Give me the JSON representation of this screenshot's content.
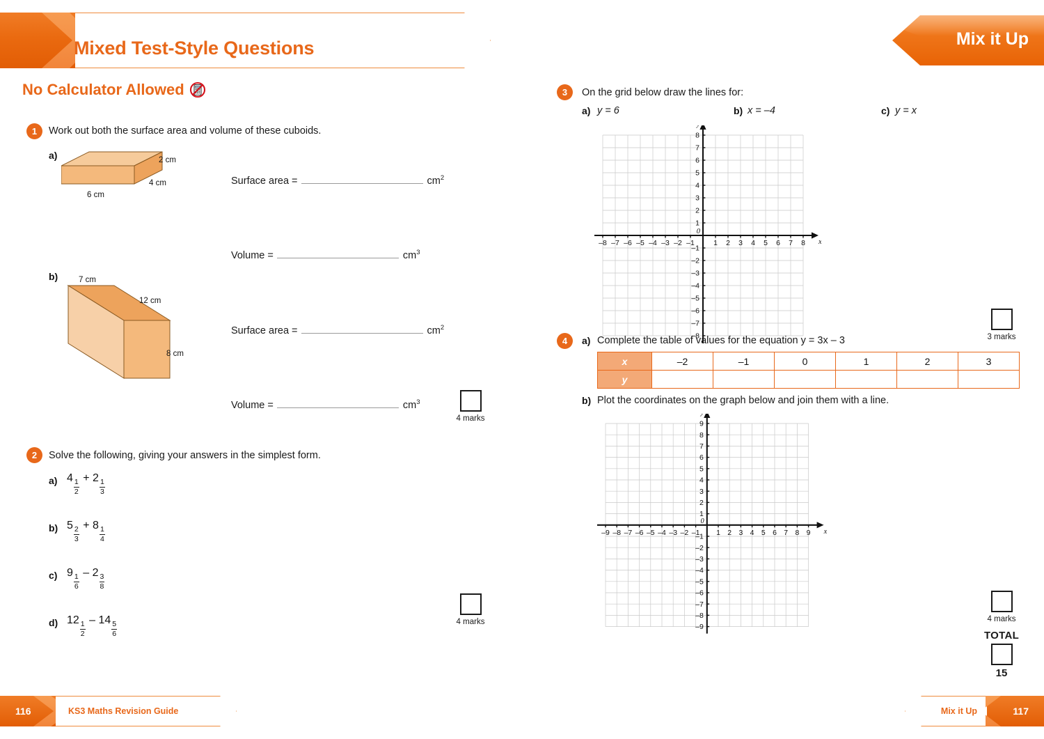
{
  "header": {
    "title": "Mixed Test-Style Questions",
    "badge": "Mix it Up",
    "section_heading": "No Calculator Allowed",
    "no_calc_icon": "no-calculator-icon"
  },
  "accent": {
    "orange": "#e8681a",
    "orange_light": "#f3a977",
    "cuboid_fill": "#f5c08a",
    "cuboid_top": "#f0ad6b"
  },
  "q1": {
    "number": "1",
    "text": "Work out both the surface area and volume of these cuboids.",
    "parts": [
      {
        "label": "a)",
        "dims": {
          "width": "6 cm",
          "depth": "4 cm",
          "height": "2 cm"
        },
        "surface_label": "Surface area =",
        "surface_unit": "cm",
        "surface_unit_sup": "2",
        "volume_label": "Volume =",
        "volume_unit": "cm",
        "volume_unit_sup": "3"
      },
      {
        "label": "b)",
        "dims": {
          "width": "7 cm",
          "depth": "12 cm",
          "height": "8 cm"
        },
        "surface_label": "Surface area =",
        "surface_unit": "cm",
        "surface_unit_sup": "2",
        "volume_label": "Volume =",
        "volume_unit": "cm",
        "volume_unit_sup": "3"
      }
    ],
    "marks": "4 marks"
  },
  "q2": {
    "number": "2",
    "text": "Solve the following, giving your answers in the simplest form.",
    "items": [
      {
        "label": "a)",
        "a_whole": "4",
        "a_num": "1",
        "a_den": "2",
        "op": "+",
        "b_whole": "2",
        "b_num": "1",
        "b_den": "3"
      },
      {
        "label": "b)",
        "a_whole": "5",
        "a_num": "2",
        "a_den": "3",
        "op": "+",
        "b_whole": "8",
        "b_num": "1",
        "b_den": "4"
      },
      {
        "label": "c)",
        "a_whole": "9",
        "a_num": "1",
        "a_den": "6",
        "op": "–",
        "b_whole": "2",
        "b_num": "3",
        "b_den": "8"
      },
      {
        "label": "d)",
        "a_whole": "12",
        "a_num": "1",
        "a_den": "2",
        "op": "–",
        "b_whole": "14",
        "b_num": "5",
        "b_den": "6"
      }
    ],
    "marks": "4 marks"
  },
  "q3": {
    "number": "3",
    "text": "On the grid below draw the lines for:",
    "parts": [
      {
        "label": "a)",
        "equation": "y = 6"
      },
      {
        "label": "b)",
        "equation": "x = –4"
      },
      {
        "label": "c)",
        "equation": "y = x"
      }
    ],
    "grid": {
      "x_min": -8,
      "x_max": 8,
      "y_min": -8,
      "y_max": 8,
      "x_axis_name": "x",
      "y_axis_name": "y",
      "origin_label": "0"
    },
    "marks": "3 marks"
  },
  "q4": {
    "number": "4",
    "part_a": {
      "label": "a)",
      "text": "Complete the table of values for the equation y = 3x – 3"
    },
    "table": {
      "row_headers": [
        "x",
        "y"
      ],
      "x_values": [
        "–2",
        "–1",
        "0",
        "1",
        "2",
        "3"
      ],
      "y_values": [
        "",
        "",
        "",
        "",
        "",
        ""
      ]
    },
    "part_b": {
      "label": "b)",
      "text": "Plot the coordinates on the graph below and join them with a line."
    },
    "grid": {
      "x_min": -9,
      "x_max": 9,
      "y_min": -9,
      "y_max": 9,
      "x_axis_name": "x",
      "y_axis_name": "y",
      "origin_label": "0"
    },
    "marks": "4 marks"
  },
  "total": {
    "label": "TOTAL",
    "value": "15"
  },
  "footer": {
    "left_page": "116",
    "left_text": "KS3 Maths Revision Guide",
    "right_text": "Mix it Up",
    "right_page": "117"
  }
}
